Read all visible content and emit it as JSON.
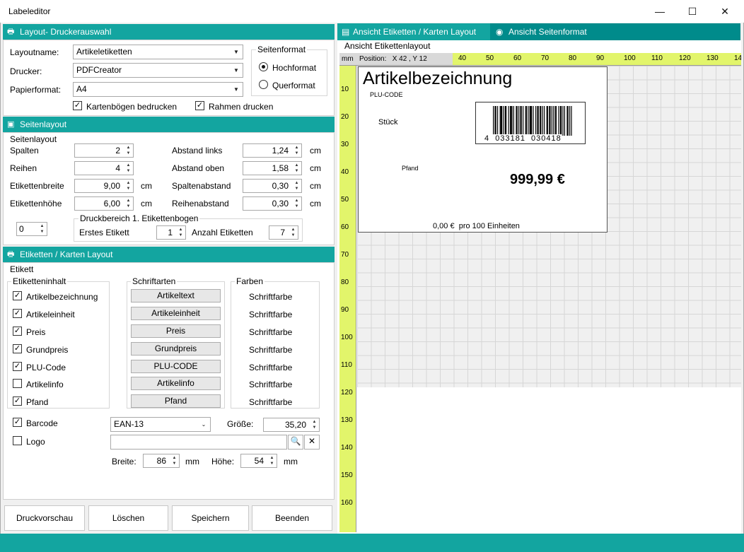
{
  "window": {
    "title": "Labeleditor",
    "minimize": "—",
    "maximize": "☐",
    "close": "✕"
  },
  "layout_section": {
    "title": "Layout- Druckerauswahl",
    "layoutname_label": "Layoutname:",
    "layoutname_value": "Artikeletiketten",
    "drucker_label": "Drucker:",
    "drucker_value": "PDFCreator",
    "papier_label": "Papierformat:",
    "papier_value": "A4",
    "kartenboegen_label": "Kartenbögen bedrucken",
    "rahmen_label": "Rahmen drucken",
    "seitenformat_title": "Seitenformat",
    "hoch_label": "Hochformat",
    "quer_label": "Querformat"
  },
  "seitenlayout": {
    "title": "Seitenlayout",
    "group_title": "Seitenlayout",
    "spalten_label": "Spalten",
    "spalten_value": "2",
    "reihen_label": "Reihen",
    "reihen_value": "4",
    "breite_label": "Etikettenbreite",
    "breite_value": "9,00",
    "hoehe_label": "Etikettenhöhe",
    "hoehe_value": "6,00",
    "unit_cm": "cm",
    "abstand_links_label": "Abstand links",
    "abstand_links_value": "1,24",
    "abstand_oben_label": "Abstand oben",
    "abstand_oben_value": "1,58",
    "spaltenabstand_label": "Spaltenabstand",
    "spaltenabstand_value": "0,30",
    "reihenabstand_label": "Reihenabstand",
    "reihenabstand_value": "0,30",
    "offset_value": "0",
    "druckbereich_title": "Druckbereich 1. Etikettenbogen",
    "erstes_label": "Erstes Etikett",
    "erstes_value": "1",
    "anzahl_label": "Anzahl Etiketten",
    "anzahl_value": "7"
  },
  "etiketten": {
    "title": "Etiketten / Karten Layout",
    "etikett_label": "Etikett",
    "inhalt_title": "Etiketteninhalt",
    "schriftarten_title": "Schriftarten",
    "farben_title": "Farben",
    "items": [
      {
        "label": "Artikelbezeichnung",
        "checked": "✓",
        "font_btn": "Artikeltext",
        "color": "Schriftfarbe"
      },
      {
        "label": "Artikeleinheit",
        "checked": "✓",
        "font_btn": "Artikeleinheit",
        "color": "Schriftfarbe"
      },
      {
        "label": "Preis",
        "checked": "✓",
        "font_btn": "Preis",
        "color": "Schriftfarbe"
      },
      {
        "label": "Grundpreis",
        "checked": "✓",
        "font_btn": "Grundpreis",
        "color": "Schriftfarbe"
      },
      {
        "label": "PLU-Code",
        "checked": "✓",
        "font_btn": "PLU-CODE",
        "color": "Schriftfarbe"
      },
      {
        "label": "Artikelinfo",
        "checked": "",
        "font_btn": "Artikelinfo",
        "color": "Schriftfarbe"
      },
      {
        "label": "Pfand",
        "checked": "✓",
        "font_btn": "Pfand",
        "color": "Schriftfarbe"
      }
    ],
    "barcode_label": "Barcode",
    "barcode_checked": "✓",
    "barcode_type": "EAN-13",
    "groesse_label": "Größe:",
    "groesse_value": "35,20",
    "logo_label": "Logo",
    "logo_checked": "",
    "logo_path": "",
    "breite_label": "Breite:",
    "breite_value": "86",
    "hoehe_label": "Höhe:",
    "hoehe_value": "54",
    "unit_mm": "mm"
  },
  "buttons": {
    "druckvorschau": "Druckvorschau",
    "loeschen": "Löschen",
    "speichern": "Speichern",
    "beenden": "Beenden"
  },
  "preview": {
    "tab1": "Ansicht Etiketten / Karten Layout",
    "tab2": "Ansicht Seitenformat",
    "group_title": "Ansicht Etikettenlayout",
    "unit": "mm",
    "position": "Position:   X 42 , Y 12",
    "h_ticks": [
      "40",
      "50",
      "60",
      "70",
      "80",
      "90",
      "100",
      "110",
      "120",
      "130",
      "14"
    ],
    "v_ticks": [
      "10",
      "20",
      "30",
      "40",
      "50",
      "60",
      "70",
      "80",
      "90",
      "100",
      "110",
      "120",
      "130",
      "140",
      "150",
      "160"
    ],
    "label": {
      "title": "Artikelbezeichnung",
      "plu": "PLU-CODE",
      "einheit": "Stück",
      "pfand": "Pfand",
      "preis": "999,99 €",
      "grundpreis": "0,00 €  pro 100 Einheiten",
      "barcode_number": "4  033181  030418"
    }
  },
  "colors": {
    "teal": "#13a5a0",
    "dark_teal": "#008b8b",
    "ruler": "#e2f56b"
  }
}
